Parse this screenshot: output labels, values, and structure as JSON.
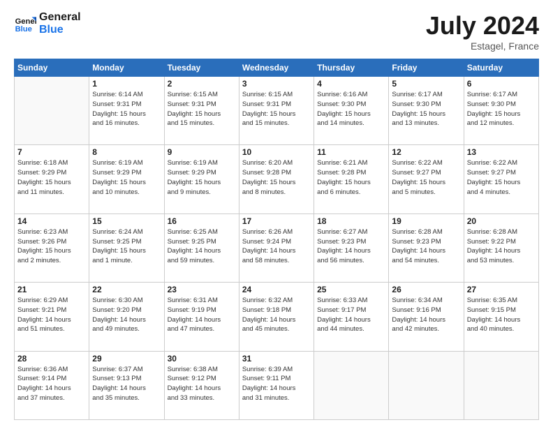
{
  "header": {
    "logo_line1": "General",
    "logo_line2": "Blue",
    "month": "July 2024",
    "location": "Estagel, France"
  },
  "weekdays": [
    "Sunday",
    "Monday",
    "Tuesday",
    "Wednesday",
    "Thursday",
    "Friday",
    "Saturday"
  ],
  "weeks": [
    [
      {
        "day": "",
        "info": ""
      },
      {
        "day": "1",
        "info": "Sunrise: 6:14 AM\nSunset: 9:31 PM\nDaylight: 15 hours\nand 16 minutes."
      },
      {
        "day": "2",
        "info": "Sunrise: 6:15 AM\nSunset: 9:31 PM\nDaylight: 15 hours\nand 15 minutes."
      },
      {
        "day": "3",
        "info": "Sunrise: 6:15 AM\nSunset: 9:31 PM\nDaylight: 15 hours\nand 15 minutes."
      },
      {
        "day": "4",
        "info": "Sunrise: 6:16 AM\nSunset: 9:30 PM\nDaylight: 15 hours\nand 14 minutes."
      },
      {
        "day": "5",
        "info": "Sunrise: 6:17 AM\nSunset: 9:30 PM\nDaylight: 15 hours\nand 13 minutes."
      },
      {
        "day": "6",
        "info": "Sunrise: 6:17 AM\nSunset: 9:30 PM\nDaylight: 15 hours\nand 12 minutes."
      }
    ],
    [
      {
        "day": "7",
        "info": "Sunrise: 6:18 AM\nSunset: 9:29 PM\nDaylight: 15 hours\nand 11 minutes."
      },
      {
        "day": "8",
        "info": "Sunrise: 6:19 AM\nSunset: 9:29 PM\nDaylight: 15 hours\nand 10 minutes."
      },
      {
        "day": "9",
        "info": "Sunrise: 6:19 AM\nSunset: 9:29 PM\nDaylight: 15 hours\nand 9 minutes."
      },
      {
        "day": "10",
        "info": "Sunrise: 6:20 AM\nSunset: 9:28 PM\nDaylight: 15 hours\nand 8 minutes."
      },
      {
        "day": "11",
        "info": "Sunrise: 6:21 AM\nSunset: 9:28 PM\nDaylight: 15 hours\nand 6 minutes."
      },
      {
        "day": "12",
        "info": "Sunrise: 6:22 AM\nSunset: 9:27 PM\nDaylight: 15 hours\nand 5 minutes."
      },
      {
        "day": "13",
        "info": "Sunrise: 6:22 AM\nSunset: 9:27 PM\nDaylight: 15 hours\nand 4 minutes."
      }
    ],
    [
      {
        "day": "14",
        "info": "Sunrise: 6:23 AM\nSunset: 9:26 PM\nDaylight: 15 hours\nand 2 minutes."
      },
      {
        "day": "15",
        "info": "Sunrise: 6:24 AM\nSunset: 9:25 PM\nDaylight: 15 hours\nand 1 minute."
      },
      {
        "day": "16",
        "info": "Sunrise: 6:25 AM\nSunset: 9:25 PM\nDaylight: 14 hours\nand 59 minutes."
      },
      {
        "day": "17",
        "info": "Sunrise: 6:26 AM\nSunset: 9:24 PM\nDaylight: 14 hours\nand 58 minutes."
      },
      {
        "day": "18",
        "info": "Sunrise: 6:27 AM\nSunset: 9:23 PM\nDaylight: 14 hours\nand 56 minutes."
      },
      {
        "day": "19",
        "info": "Sunrise: 6:28 AM\nSunset: 9:23 PM\nDaylight: 14 hours\nand 54 minutes."
      },
      {
        "day": "20",
        "info": "Sunrise: 6:28 AM\nSunset: 9:22 PM\nDaylight: 14 hours\nand 53 minutes."
      }
    ],
    [
      {
        "day": "21",
        "info": "Sunrise: 6:29 AM\nSunset: 9:21 PM\nDaylight: 14 hours\nand 51 minutes."
      },
      {
        "day": "22",
        "info": "Sunrise: 6:30 AM\nSunset: 9:20 PM\nDaylight: 14 hours\nand 49 minutes."
      },
      {
        "day": "23",
        "info": "Sunrise: 6:31 AM\nSunset: 9:19 PM\nDaylight: 14 hours\nand 47 minutes."
      },
      {
        "day": "24",
        "info": "Sunrise: 6:32 AM\nSunset: 9:18 PM\nDaylight: 14 hours\nand 45 minutes."
      },
      {
        "day": "25",
        "info": "Sunrise: 6:33 AM\nSunset: 9:17 PM\nDaylight: 14 hours\nand 44 minutes."
      },
      {
        "day": "26",
        "info": "Sunrise: 6:34 AM\nSunset: 9:16 PM\nDaylight: 14 hours\nand 42 minutes."
      },
      {
        "day": "27",
        "info": "Sunrise: 6:35 AM\nSunset: 9:15 PM\nDaylight: 14 hours\nand 40 minutes."
      }
    ],
    [
      {
        "day": "28",
        "info": "Sunrise: 6:36 AM\nSunset: 9:14 PM\nDaylight: 14 hours\nand 37 minutes."
      },
      {
        "day": "29",
        "info": "Sunrise: 6:37 AM\nSunset: 9:13 PM\nDaylight: 14 hours\nand 35 minutes."
      },
      {
        "day": "30",
        "info": "Sunrise: 6:38 AM\nSunset: 9:12 PM\nDaylight: 14 hours\nand 33 minutes."
      },
      {
        "day": "31",
        "info": "Sunrise: 6:39 AM\nSunset: 9:11 PM\nDaylight: 14 hours\nand 31 minutes."
      },
      {
        "day": "",
        "info": ""
      },
      {
        "day": "",
        "info": ""
      },
      {
        "day": "",
        "info": ""
      }
    ]
  ]
}
